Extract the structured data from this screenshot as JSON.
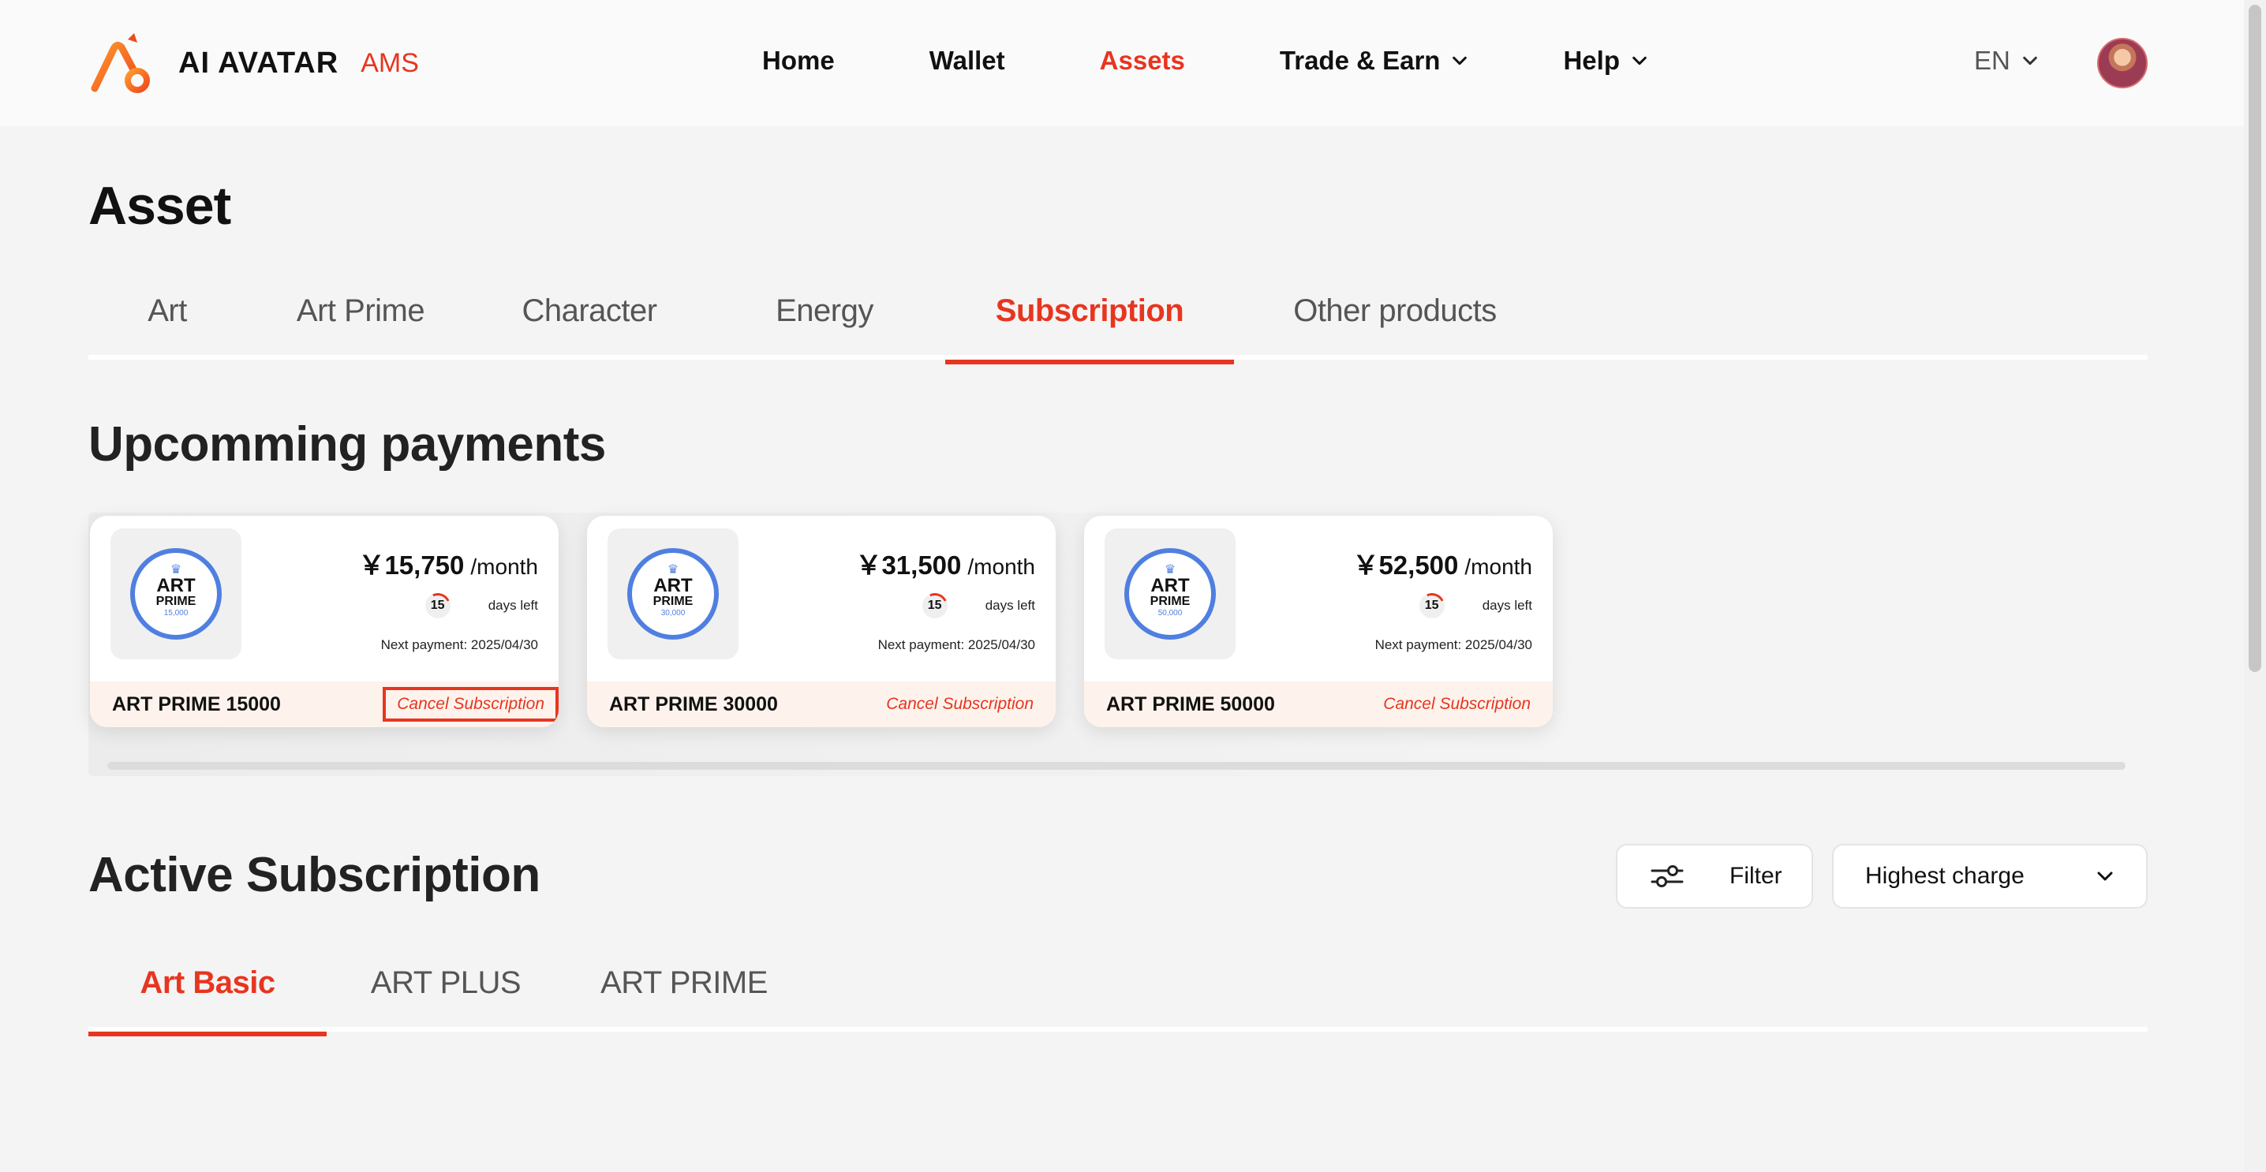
{
  "header": {
    "brand_name": "AI AVATAR",
    "brand_suffix": "AMS",
    "nav": [
      {
        "label": "Home"
      },
      {
        "label": "Wallet"
      },
      {
        "label": "Assets"
      },
      {
        "label": "Trade & Earn"
      },
      {
        "label": "Help"
      }
    ],
    "language": "EN"
  },
  "page": {
    "title": "Asset",
    "tabs": [
      {
        "label": "Art"
      },
      {
        "label": "Art Prime"
      },
      {
        "label": "Character"
      },
      {
        "label": "Energy"
      },
      {
        "label": "Subscription"
      },
      {
        "label": "Other products"
      }
    ],
    "active_tab": "Subscription"
  },
  "upcoming": {
    "title": "Upcomming payments",
    "cards": [
      {
        "badge_art": "ART",
        "badge_prime": "PRIME",
        "badge_num": "15,000",
        "amount": "￥15,750",
        "per": "/month",
        "days": "15",
        "days_label": "days left",
        "next_payment": "Next payment: 2025/04/30",
        "plan_name": "ART PRIME 15000",
        "cancel": "Cancel Subscription"
      },
      {
        "badge_art": "ART",
        "badge_prime": "PRIME",
        "badge_num": "30,000",
        "amount": "￥31,500",
        "per": "/month",
        "days": "15",
        "days_label": "days left",
        "next_payment": "Next payment: 2025/04/30",
        "plan_name": "ART PRIME 30000",
        "cancel": "Cancel Subscription"
      },
      {
        "badge_art": "ART",
        "badge_prime": "PRIME",
        "badge_num": "50,000",
        "amount": "￥52,500",
        "per": "/month",
        "days": "15",
        "days_label": "days left",
        "next_payment": "Next payment: 2025/04/30",
        "plan_name": "ART PRIME 50000",
        "cancel": "Cancel Subscription"
      }
    ]
  },
  "active": {
    "title": "Active Subscription",
    "filter_label": "Filter",
    "sort_selected": "Highest charge",
    "tabs": [
      {
        "label": "Art Basic"
      },
      {
        "label": "ART PLUS"
      },
      {
        "label": "ART PRIME"
      }
    ],
    "active_tab": "Art Basic"
  },
  "colors": {
    "accent": "#e8351f",
    "badge_blue": "#4f7fe0",
    "card_footer": "#fdf3ec",
    "background": "#f4f4f4"
  },
  "icons": {
    "logo": "brand-logo-icon",
    "chevron": "chevron-down-icon",
    "filter": "sliders-icon",
    "crown": "crown-icon"
  }
}
